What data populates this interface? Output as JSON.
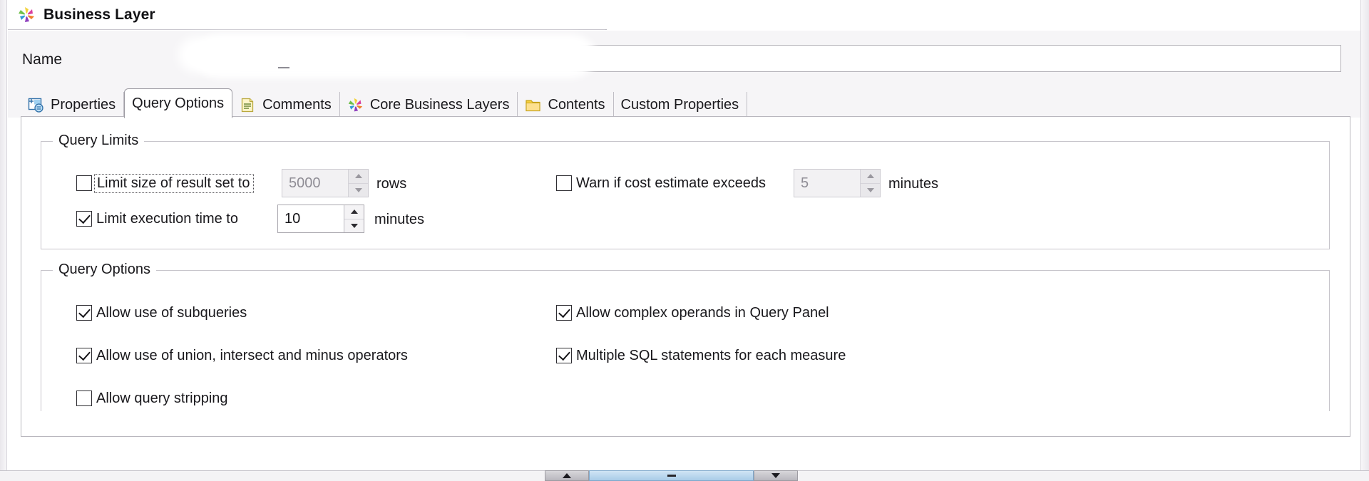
{
  "window": {
    "title": "Business Layer",
    "title_icon": "star-burst-icon"
  },
  "name_row": {
    "label": "Name",
    "value": "",
    "placeholder": ""
  },
  "tabs": [
    {
      "label": "Properties",
      "icon": "properties-icon",
      "selected": false
    },
    {
      "label": "Query Options",
      "icon": "",
      "selected": true
    },
    {
      "label": "Comments",
      "icon": "comments-icon",
      "selected": false
    },
    {
      "label": "Core Business Layers",
      "icon": "star-burst-icon",
      "selected": false
    },
    {
      "label": "Contents",
      "icon": "folder-icon",
      "selected": false
    },
    {
      "label": "Custom Properties",
      "icon": "",
      "selected": false
    }
  ],
  "query_limits": {
    "title": "Query Limits",
    "limit_result_set": {
      "label": "Limit size of result set to",
      "checked": false,
      "value": "5000",
      "unit": "rows",
      "enabled": false
    },
    "limit_execution_time": {
      "label": "Limit execution time to",
      "checked": true,
      "value": "10",
      "unit": "minutes",
      "enabled": true
    },
    "warn_cost_estimate": {
      "label": "Warn if cost estimate exceeds",
      "checked": false,
      "value": "5",
      "unit": "minutes",
      "enabled": false
    }
  },
  "query_options": {
    "title": "Query Options",
    "left_column": [
      {
        "label": "Allow use of subqueries",
        "checked": true
      },
      {
        "label": "Allow use of union, intersect and minus operators",
        "checked": true
      },
      {
        "label": "Allow query stripping",
        "checked": false
      }
    ],
    "right_column": [
      {
        "label": "Allow complex operands in Query Panel",
        "checked": true
      },
      {
        "label": "Multiple SQL statements for each measure",
        "checked": true
      }
    ]
  },
  "scrollbar": {
    "left_arrow": "▲",
    "right_arrow": "▼"
  },
  "colors": {
    "panel_bg": "#ffffff",
    "chrome_bg": "#f6f5f7",
    "border": "#b9b7be",
    "text": "#19181c",
    "scroll_thumb": "#a8cbe8"
  }
}
